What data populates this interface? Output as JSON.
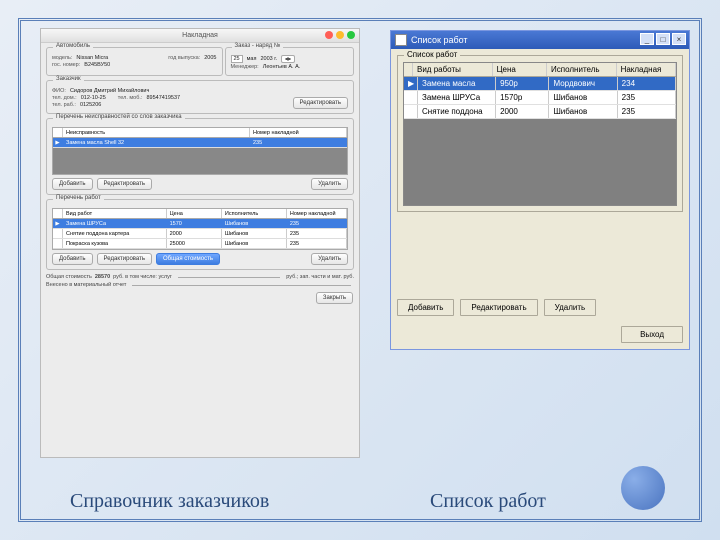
{
  "captions": {
    "left": "Справочник заказчиков",
    "right": "Список работ"
  },
  "left": {
    "title": "Накладная",
    "car": {
      "group": "Автомобиль",
      "model_l": "модель:",
      "model": "Nissan Micra",
      "year_l": "год выпуска:",
      "year": "2005",
      "plate_l": "гос. номер:",
      "plate": "В245ВУ50"
    },
    "order": {
      "group": "Заказ - наряд №",
      "date_parts": [
        "25",
        "мая",
        "2003 г."
      ],
      "manager_l": "Менеджер:",
      "manager": "Леонтьев А. А."
    },
    "customer": {
      "group": "Заказчик",
      "fio_l": "ФИО:",
      "fio": "Сидоров Дмитрий Михайлович",
      "phone_home_l": "тел. дом.:",
      "phone_home": "012-10-25",
      "phone_work_l": "тел. раб.:",
      "phone_work": "0125206",
      "phone_mob_l": "тел. моб.:",
      "phone_mob": "89547419537",
      "edit": "Редактировать"
    },
    "faults": {
      "group": "Перечень неисправностей со слов заказчика",
      "cols": [
        "Неисправность",
        "Номер накладной"
      ],
      "rows": [
        {
          "name": "Замена масла Shell 32",
          "num": "235"
        }
      ],
      "add": "Добавить",
      "edit": "Редактировать",
      "del": "Удалить"
    },
    "works": {
      "group": "Перечень работ",
      "cols": [
        "Вид работ",
        "Цена",
        "Исполнитель",
        "Номер накладной"
      ],
      "rows": [
        {
          "name": "Замена ШРУСа",
          "price": "1570",
          "exec": "Шибанов",
          "num": "235"
        },
        {
          "name": "Снятие поддона картера",
          "price": "2000",
          "exec": "Шибанов",
          "num": "235"
        },
        {
          "name": "Покраска кузова",
          "price": "25000",
          "exec": "Шибанов",
          "num": "235"
        }
      ],
      "add": "Добавить",
      "edit": "Редактировать",
      "total_btn": "Общая стоимость",
      "del": "Удалить"
    },
    "summary": {
      "l1a": "Общая стоимость",
      "total": "28570",
      "l1b": "руб. в том числе: услуг",
      "l1c": "руб.; зап. части и мат. руб.",
      "l2": "Внесено в материальный отчет"
    },
    "close": "Закрыть"
  },
  "right": {
    "title": "Список работ",
    "group": "Список работ",
    "cols": [
      "Вид работы",
      "Цена",
      "Исполнитель",
      "Накладная"
    ],
    "rows": [
      {
        "name": "Замена масла",
        "price": "950р",
        "exec": "Мордвович",
        "num": "234"
      },
      {
        "name": "Замена ШРУСа",
        "price": "1570р",
        "exec": "Шибанов",
        "num": "235"
      },
      {
        "name": "Снятие поддона",
        "price": "2000",
        "exec": "Шибанов",
        "num": "235"
      }
    ],
    "add": "Добавить",
    "edit": "Редактировать",
    "del": "Удалить",
    "exit": "Выход"
  }
}
